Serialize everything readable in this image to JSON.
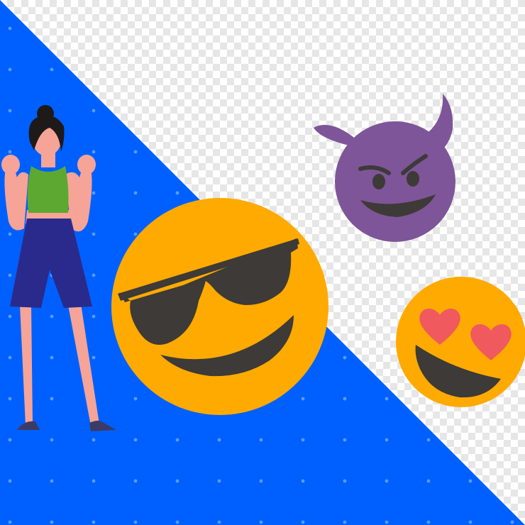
{
  "scene": {
    "background": "transparent-checkerboard",
    "colors": {
      "panel_blue": "#0060FF",
      "dot": "#5A9BFF",
      "emoji_yellow": "#FFAA00",
      "emoji_feature": "#3D3A37",
      "devil_purple": "#7E5598",
      "heart_red": "#F0595E",
      "skin": "#F5A497",
      "hair": "#1E1A1A",
      "top_green": "#5DA830",
      "shorts_navy": "#2A2A8C",
      "shoe": "#3B3B66"
    },
    "icons": [
      "woman-figure",
      "sunglasses-emoji",
      "devil-emoji",
      "heart-eyes-emoji"
    ]
  }
}
